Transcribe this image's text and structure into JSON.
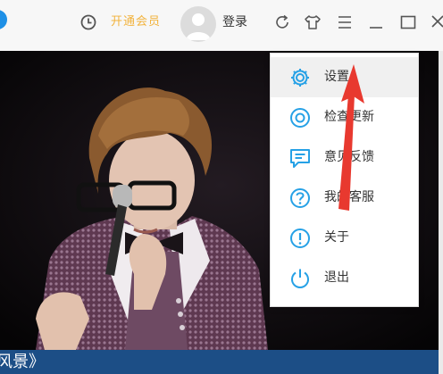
{
  "header": {
    "vip_label": "开通会员",
    "login_label": "登录"
  },
  "menu": {
    "items": [
      {
        "label": "设置",
        "icon": "gear-icon"
      },
      {
        "label": "检查更新",
        "icon": "update-icon"
      },
      {
        "label": "意见反馈",
        "icon": "feedback-icon"
      },
      {
        "label": "我的客服",
        "icon": "help-icon"
      },
      {
        "label": "关于",
        "icon": "info-icon"
      },
      {
        "label": "退出",
        "icon": "power-icon"
      }
    ]
  },
  "player": {
    "song_title": "风景》"
  },
  "colors": {
    "accent_blue": "#26a1e6",
    "vip_gold": "#f2b33d",
    "arrow_red": "#e8392f",
    "bottom_bar": "#1c4e86"
  }
}
